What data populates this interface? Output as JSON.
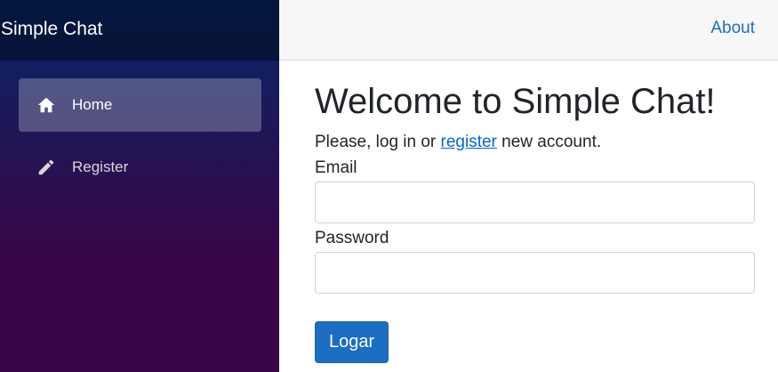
{
  "app": {
    "brand": "Simple Chat"
  },
  "sidebar": {
    "items": [
      {
        "label": "Home",
        "icon": "home-icon",
        "active": true
      },
      {
        "label": "Register",
        "icon": "pencil-icon",
        "active": false
      }
    ]
  },
  "topbar": {
    "about_label": "About"
  },
  "main": {
    "title": "Welcome to Simple Chat!",
    "intro_before": "Please, log in or ",
    "intro_link": "register",
    "intro_after": " new account.",
    "email_label": "Email",
    "email_value": "",
    "password_label": "Password",
    "password_value": "",
    "submit_label": "Logar"
  },
  "colors": {
    "accent": "#1b6ec2",
    "sidebar_top": "#052767",
    "sidebar_bottom": "#3a0647"
  }
}
